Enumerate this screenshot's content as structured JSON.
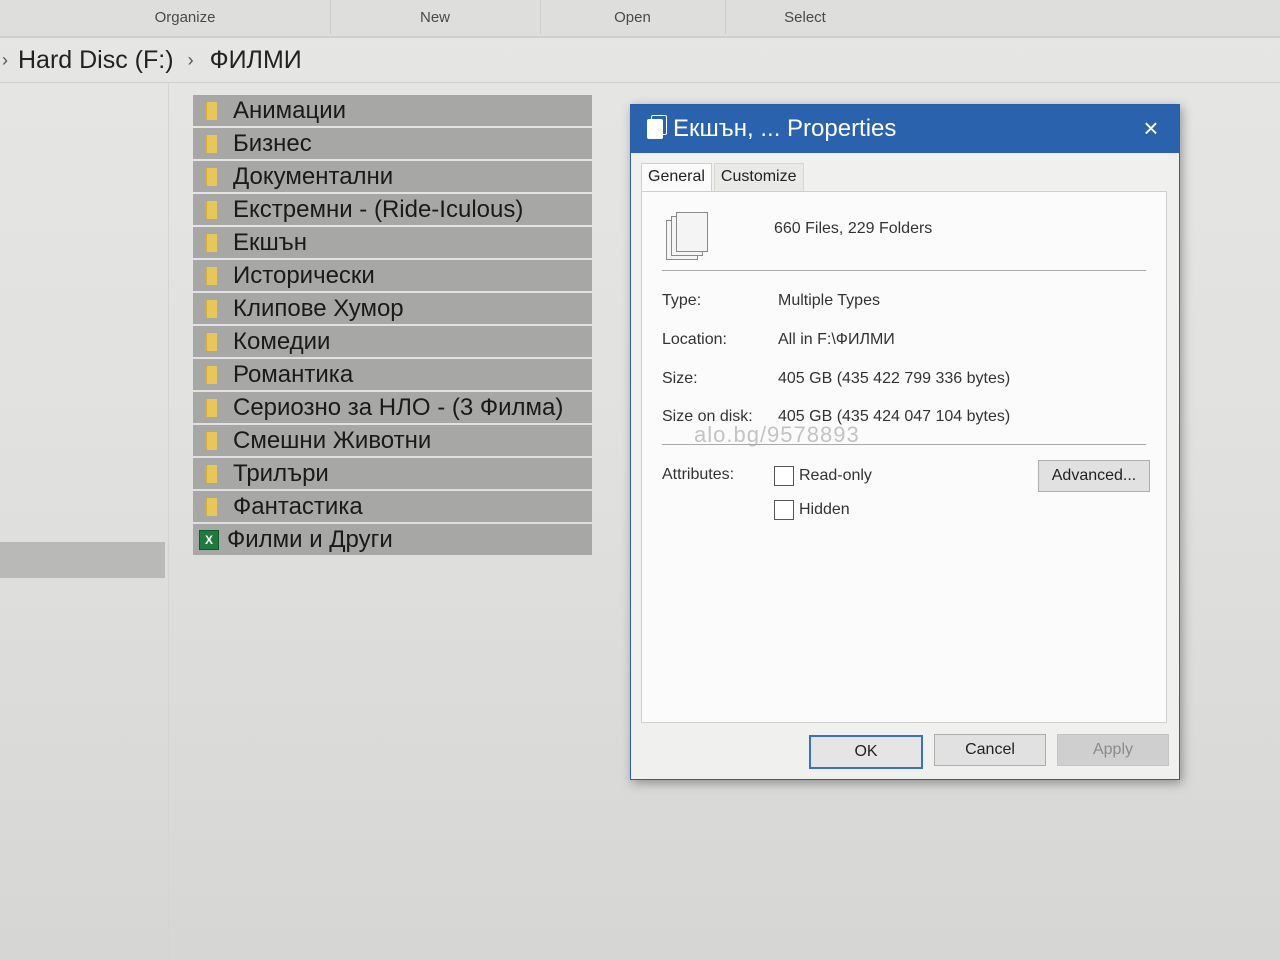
{
  "ribbon": {
    "groups": [
      "Organize",
      "New",
      "Open",
      "Select"
    ]
  },
  "address": {
    "crumbs": [
      "Hard Disc (F:)",
      "ФИЛМИ"
    ]
  },
  "files": [
    {
      "name": "Анимации",
      "type": "folder"
    },
    {
      "name": "Бизнес",
      "type": "folder"
    },
    {
      "name": "Документални",
      "type": "folder"
    },
    {
      "name": "Екстремни - (Ride-Iculous)",
      "type": "folder"
    },
    {
      "name": "Екшън",
      "type": "folder"
    },
    {
      "name": "Исторически",
      "type": "folder"
    },
    {
      "name": "Клипове Хумор",
      "type": "folder"
    },
    {
      "name": "Комедии",
      "type": "folder"
    },
    {
      "name": "Романтика",
      "type": "folder"
    },
    {
      "name": "Сериозно за НЛО - (3 Филма)",
      "type": "folder"
    },
    {
      "name": "Смешни Животни",
      "type": "folder"
    },
    {
      "name": "Трилъри",
      "type": "folder"
    },
    {
      "name": "Фантастика",
      "type": "folder"
    },
    {
      "name": "Филми и Други",
      "type": "excel"
    }
  ],
  "dialog": {
    "title": "Екшън, ... Properties",
    "close_icon": "×",
    "tabs": [
      "General",
      "Customize"
    ],
    "summary": "660 Files, 229 Folders",
    "properties": [
      {
        "label": "Type:",
        "value": "Multiple Types"
      },
      {
        "label": "Location:",
        "value": "All in F:\\ФИЛМИ"
      },
      {
        "label": "Size:",
        "value": "405 GB (435 422 799 336 bytes)"
      },
      {
        "label": "Size on disk:",
        "value": "405 GB (435 424 047 104 bytes)"
      }
    ],
    "attributes_label": "Attributes:",
    "readonly_label": "Read-only",
    "hidden_label": "Hidden",
    "advanced_label": "Advanced...",
    "ok_label": "OK",
    "cancel_label": "Cancel",
    "apply_label": "Apply",
    "watermark": "alo.bg/9578893"
  },
  "colors": {
    "title_bar": "#2b62ae",
    "selection": "#a7a7a5"
  }
}
